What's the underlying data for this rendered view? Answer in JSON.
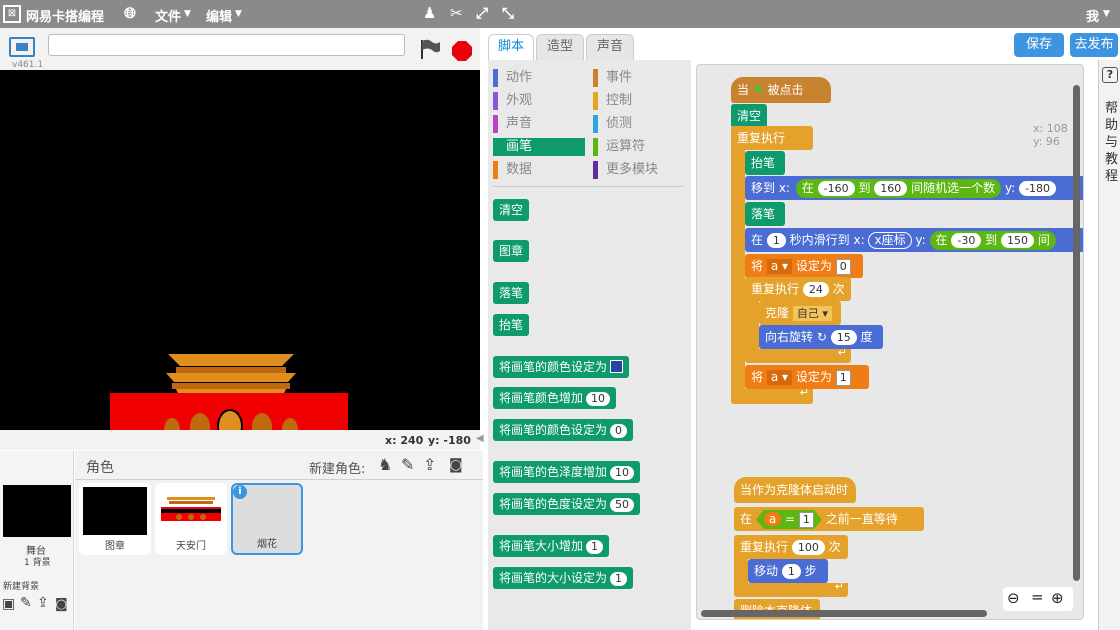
{
  "menubar": {
    "app_name": "网易卡搭编程",
    "file": "文件",
    "edit": "编辑",
    "user": "我"
  },
  "stage": {
    "version": "v461.1",
    "project_name": "",
    "coords_x": "x: 240",
    "coords_y": "y: -180"
  },
  "sprites": {
    "header": "角色",
    "new_sprite": "新建角色:",
    "stage_label": "舞台",
    "stage_bg_count": "1 背景",
    "new_backdrop": "新建背景",
    "items": [
      {
        "name": "图章"
      },
      {
        "name": "天安门"
      },
      {
        "name": "烟花"
      }
    ]
  },
  "tabs": {
    "scripts": "脚本",
    "costumes": "造型",
    "sounds": "声音"
  },
  "buttons": {
    "save": "保存",
    "publish": "去发布"
  },
  "categories": [
    {
      "label": "动作",
      "color": "#4a6cd4"
    },
    {
      "label": "事件",
      "color": "#c88330"
    },
    {
      "label": "外观",
      "color": "#8a55d7"
    },
    {
      "label": "控制",
      "color": "#e1a91a"
    },
    {
      "label": "声音",
      "color": "#bb42c3"
    },
    {
      "label": "侦测",
      "color": "#2ca5e2"
    },
    {
      "label": "画笔",
      "color": "#0e9a6c"
    },
    {
      "label": "运算符",
      "color": "#5cb712"
    },
    {
      "label": "数据",
      "color": "#ee7d16"
    },
    {
      "label": "更多模块",
      "color": "#632d99"
    }
  ],
  "palette": {
    "clear": "清空",
    "stamp": "图章",
    "pen_down": "落笔",
    "pen_up": "抬笔",
    "set_color": "将画笔的颜色设定为",
    "change_color": "将画笔颜色增加",
    "change_color_val": "10",
    "set_color2": "将画笔的颜色设定为",
    "set_color2_val": "0",
    "change_shade": "将画笔的色泽度增加",
    "change_shade_val": "10",
    "set_shade": "将画笔的色度设定为",
    "set_shade_val": "50",
    "change_size": "将画笔大小增加",
    "change_size_val": "1",
    "set_size": "将画笔的大小设定为",
    "set_size_val": "1"
  },
  "script": {
    "xy_x": "x: 108",
    "xy_y": "y: 96",
    "when_flag_a": "当",
    "when_flag_b": "被点击",
    "clear": "清空",
    "forever": "重复执行",
    "pen_up": "抬笔",
    "goto": "移到 x:",
    "in": "在",
    "rand_min": "-160",
    "to": "到",
    "rand_max": "160",
    "rand_txt": "间随机选一个数",
    "goto_y": "y:",
    "goto_yval": "-180",
    "pen_down": "落笔",
    "glide_a": "在",
    "glide_secs": "1",
    "glide_b": "秒内滑行到 x:",
    "glide_xvar": "x座标",
    "glide_y": "y:",
    "glide_in": "在",
    "glide_min": "-30",
    "glide_to": "到",
    "glide_max": "150",
    "glide_cut": "间",
    "set_a": "将",
    "var_a": "a",
    "set_to": "设定为",
    "set_val0": "0",
    "repeat": "重复执行",
    "repeat_n": "24",
    "times": "次",
    "clone": "克隆",
    "clone_self": "自己",
    "turn": "向右旋转",
    "turn_deg": "15",
    "deg": "度",
    "set_val1": "1",
    "when_clone": "当作为克隆体启动时",
    "wait_in": "在",
    "eq_var": "a",
    "eq": "=",
    "eq_val": "1",
    "wait_until": "之前一直等待",
    "repeat2": "重复执行",
    "repeat2_n": "100",
    "times2": "次",
    "move": "移动",
    "move_n": "1",
    "steps": "步",
    "delete_clone": "删除本克隆体"
  },
  "help": {
    "label": "帮助与教程",
    "q": "?"
  }
}
